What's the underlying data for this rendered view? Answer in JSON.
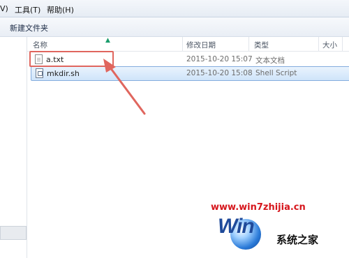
{
  "menubar": {
    "items": [
      "V)",
      "工具(T)",
      "帮助(H)"
    ]
  },
  "toolbar": {
    "new_folder": "新建文件夹"
  },
  "columns": {
    "name": "名称",
    "modified": "修改日期",
    "type": "类型",
    "size": "大小"
  },
  "files": [
    {
      "name": "a.txt",
      "modified": "2015-10-20 15:07",
      "type": "文本文档",
      "icon": "text-file-icon",
      "selected": false,
      "size_partial": ""
    },
    {
      "name": "mkdir.sh",
      "modified": "2015-10-20 15:08",
      "type": "Shell Script",
      "icon": "script-file-icon",
      "selected": true,
      "size_partial": ""
    }
  ],
  "watermark": {
    "url": "www.win7zhijia.cn",
    "logo_text": "系统之家",
    "logo_word": "Win"
  },
  "colors": {
    "annotation": "#e0665e",
    "selection_border": "#84acdd",
    "watermark_red": "#d6161c",
    "logo_blue": "#1f4a9a"
  }
}
